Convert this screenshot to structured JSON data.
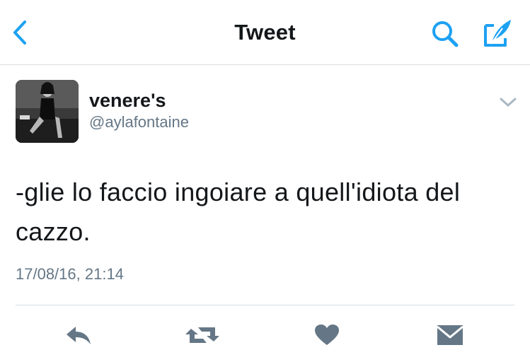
{
  "header": {
    "title": "Tweet"
  },
  "tweet": {
    "display_name": "venere's",
    "handle": "@aylafontaine",
    "text": "-glie lo faccio ingoiare a quell'idiota del cazzo.",
    "timestamp": "17/08/16, 21:14"
  },
  "icons": {
    "back": "chevron-left-icon",
    "search": "search-icon",
    "compose": "compose-icon",
    "more": "chevron-down-icon",
    "reply": "reply-icon",
    "retweet": "retweet-icon",
    "like": "heart-icon",
    "message": "envelope-icon"
  },
  "colors": {
    "accent": "#1da1f2",
    "action_gray": "#657786",
    "divider": "#d8dde1"
  }
}
